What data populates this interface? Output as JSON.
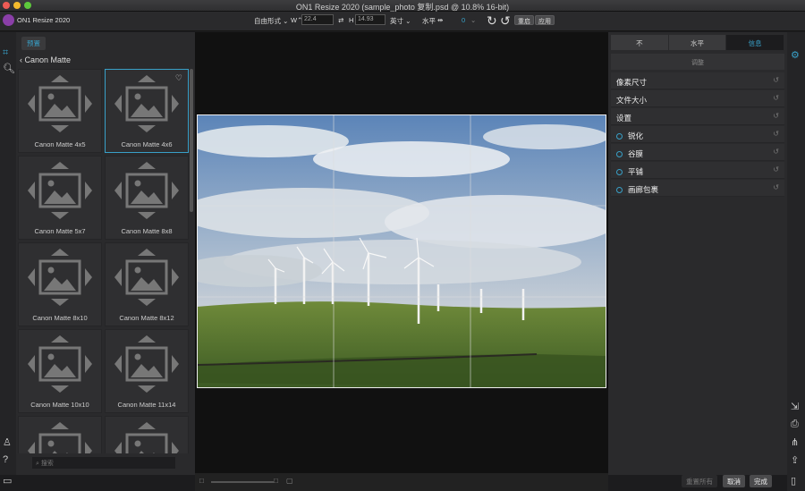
{
  "window": {
    "title": "ON1 Resize 2020 (sample_photo 复制.psd @ 10.8% 16-bit)"
  },
  "toolbar": {
    "app_name": "ON1 Resize 2020",
    "freeform": "自由形式",
    "w_label": "W",
    "width_value": "22.4",
    "h_label": "H",
    "height_value": "14.93",
    "unit": "英寸",
    "horizontal": "水平",
    "angle_value": "0",
    "reset_label": "重启",
    "apply_label": "应用"
  },
  "left_panel": {
    "preset_tab": "预置",
    "back_label": "Canon Matte",
    "search_placeholder": "搜索",
    "tiles": [
      {
        "label": "Canon Matte 4x5"
      },
      {
        "label": "Canon Matte 4x6"
      },
      {
        "label": "Canon Matte 5x7"
      },
      {
        "label": "Canon Matte 8x8"
      },
      {
        "label": "Canon Matte 8x10"
      },
      {
        "label": "Canon Matte 8x12"
      },
      {
        "label": "Canon Matte 10x10"
      },
      {
        "label": "Canon Matte 11x14"
      },
      {
        "label": ""
      },
      {
        "label": ""
      }
    ]
  },
  "right_panel": {
    "tabs": [
      "不",
      "水平",
      "信息"
    ],
    "active_tab": 2,
    "adjust_label": "调整",
    "sections": [
      {
        "label": "像素尺寸",
        "toggle": false
      },
      {
        "label": "文件大小",
        "toggle": false
      },
      {
        "label": "设置",
        "toggle": false
      },
      {
        "label": "锐化",
        "toggle": true
      },
      {
        "label": "谷膜",
        "toggle": true
      },
      {
        "label": "平铺",
        "toggle": true
      },
      {
        "label": "画廊包裹",
        "toggle": true
      }
    ]
  },
  "footer": {
    "reset_all": "重置所有",
    "cancel": "取消",
    "done": "完成"
  },
  "colors": {
    "accent": "#38a0c8",
    "background": "#1c1c1e",
    "panel": "#2a2a2c"
  }
}
